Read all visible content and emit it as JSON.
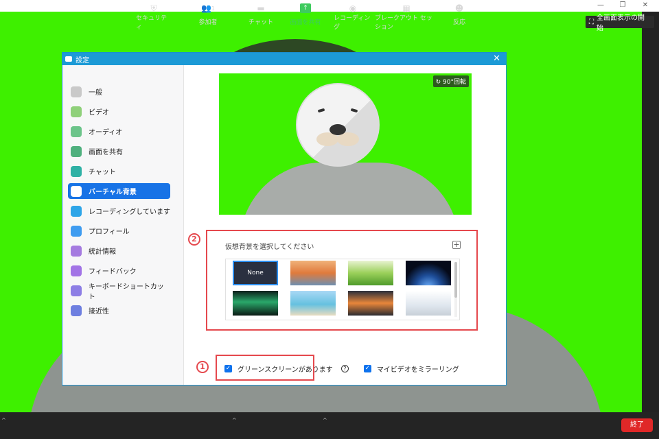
{
  "window": {
    "minimize": "—",
    "restore": "❐",
    "close": "✕"
  },
  "fullscreen": {
    "label": "全画面表示の開始"
  },
  "dialog": {
    "title": "設定",
    "close": "✕",
    "preview": {
      "rotate_label": "90°回転"
    },
    "background": {
      "title": "仮想背景を選択してください",
      "add_label": "+",
      "thumbnails": [
        {
          "label": "None",
          "selected": true
        },
        {
          "label": "",
          "scene": "golden-gate-bridge"
        },
        {
          "label": "",
          "scene": "grass"
        },
        {
          "label": "",
          "scene": "earth-from-space"
        },
        {
          "label": "",
          "scene": "aurora"
        },
        {
          "label": "",
          "scene": "beach-palm"
        },
        {
          "label": "",
          "scene": "sunset-pier"
        },
        {
          "label": "",
          "scene": "office-room"
        }
      ]
    },
    "checkboxes": {
      "green_screen": "グリーンスクリーンがあります",
      "mirror": "マイビデオをミラーリング",
      "help": "?"
    }
  },
  "sidebar": {
    "items": [
      {
        "label": "一般",
        "icon": "gear-icon",
        "color": "#c9c9c9"
      },
      {
        "label": "ビデオ",
        "icon": "video-icon",
        "color": "#8fd07a"
      },
      {
        "label": "オーディオ",
        "icon": "headphones-icon",
        "color": "#6cc48a"
      },
      {
        "label": "画面を共有",
        "icon": "share-screen-icon",
        "color": "#4fb07e"
      },
      {
        "label": "チャット",
        "icon": "chat-icon",
        "color": "#2fb1a5"
      },
      {
        "label": "バーチャル背景",
        "icon": "virtual-background-icon",
        "color": "#1773e6",
        "active": true
      },
      {
        "label": "レコーディングしています",
        "icon": "record-icon",
        "color": "#2ea5e8"
      },
      {
        "label": "プロフィール",
        "icon": "profile-icon",
        "color": "#3f9cf0"
      },
      {
        "label": "統計情報",
        "icon": "stats-icon",
        "color": "#a57be0"
      },
      {
        "label": "フィードバック",
        "icon": "feedback-icon",
        "color": "#a274e6"
      },
      {
        "label": "キーボードショートカット",
        "icon": "keyboard-icon",
        "color": "#8d7ee5"
      },
      {
        "label": "接近性",
        "icon": "accessibility-icon",
        "color": "#6e7fe0"
      }
    ]
  },
  "annotations": {
    "one": "1",
    "two": "2"
  },
  "toolbar": {
    "security": "セキュリティ",
    "participants": "参加者",
    "participants_count": "1",
    "chat": "チャット",
    "share": "画面を共有",
    "recording": "レコーディング",
    "breakout": "ブレークアウト セッション",
    "reactions": "反応",
    "end": "終了",
    "caret": "^"
  }
}
